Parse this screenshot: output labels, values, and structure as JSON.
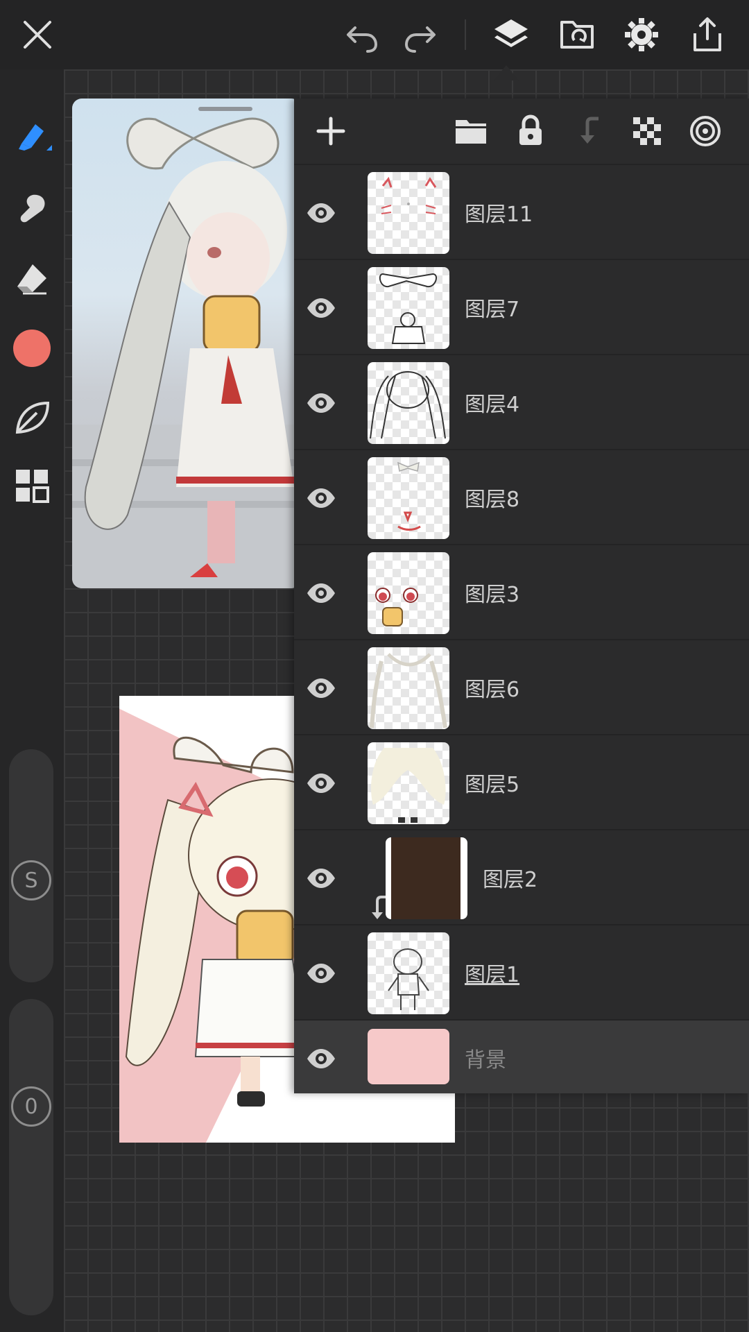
{
  "top_bar": {
    "icons": [
      "close-icon",
      "undo-icon",
      "redo-icon",
      "layers-icon",
      "folder-sync-icon",
      "gear-icon",
      "share-icon"
    ]
  },
  "left_toolbar": {
    "icons": [
      "pen-icon",
      "smudge-icon",
      "eraser-icon",
      "color-swatch",
      "leaf-icon",
      "grid-icon"
    ],
    "current_color": "#ee7268",
    "accent": "#2f8fff",
    "size_label": "S",
    "opacity_label": "0"
  },
  "layers_panel": {
    "toolbar_icons": [
      "add-layer-icon",
      "folder-icon",
      "lock-icon",
      "merge-down-icon",
      "transparency-icon",
      "target-icon"
    ],
    "layers": [
      {
        "name": "图层11",
        "clipped": false,
        "current": false
      },
      {
        "name": "图层7",
        "clipped": false,
        "current": false
      },
      {
        "name": "图层4",
        "clipped": false,
        "current": false
      },
      {
        "name": "图层8",
        "clipped": false,
        "current": false
      },
      {
        "name": "图层3",
        "clipped": false,
        "current": false
      },
      {
        "name": "图层6",
        "clipped": false,
        "current": false
      },
      {
        "name": "图层5",
        "clipped": false,
        "current": false
      },
      {
        "name": "图层2",
        "clipped": true,
        "current": false
      },
      {
        "name": "图层1",
        "clipped": false,
        "current": true
      }
    ],
    "background_layer": {
      "name": "背景",
      "color": "#f6c9c9"
    }
  }
}
